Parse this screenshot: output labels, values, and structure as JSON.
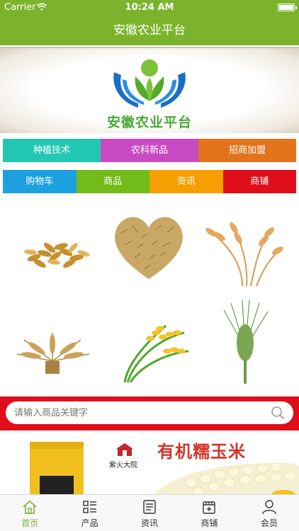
{
  "status": {
    "carrier": "Carrier",
    "time": "10:24 AM"
  },
  "nav": {
    "title": "安徽农业平台"
  },
  "banner": {
    "brand": "安徽农业平台"
  },
  "categories_row1": [
    {
      "label": "种植技术",
      "color": "#22c8b4"
    },
    {
      "label": "农科新品",
      "color": "#c84bc4"
    },
    {
      "label": "招商加盟",
      "color": "#e3741c"
    }
  ],
  "categories_row2": [
    {
      "label": "购物车",
      "color": "#1da0e0"
    },
    {
      "label": "商品",
      "color": "#72bb18"
    },
    {
      "label": "资讯",
      "color": "#f5a000"
    },
    {
      "label": "商铺",
      "color": "#e00e1a"
    }
  ],
  "search": {
    "placeholder": "请输入商品关键字"
  },
  "promo": {
    "brand_text": "紫火大院",
    "title": "有机糯玉米"
  },
  "tabbar": [
    {
      "label": "首页",
      "icon": "home-icon",
      "active": true
    },
    {
      "label": "产品",
      "icon": "list-icon",
      "active": false
    },
    {
      "label": "资讯",
      "icon": "news-icon",
      "active": false
    },
    {
      "label": "商铺",
      "icon": "store-icon",
      "active": false
    },
    {
      "label": "会员",
      "icon": "user-icon",
      "active": false
    }
  ],
  "colors": {
    "primary": "#7cb32c",
    "accent_red": "#e00e1a"
  }
}
